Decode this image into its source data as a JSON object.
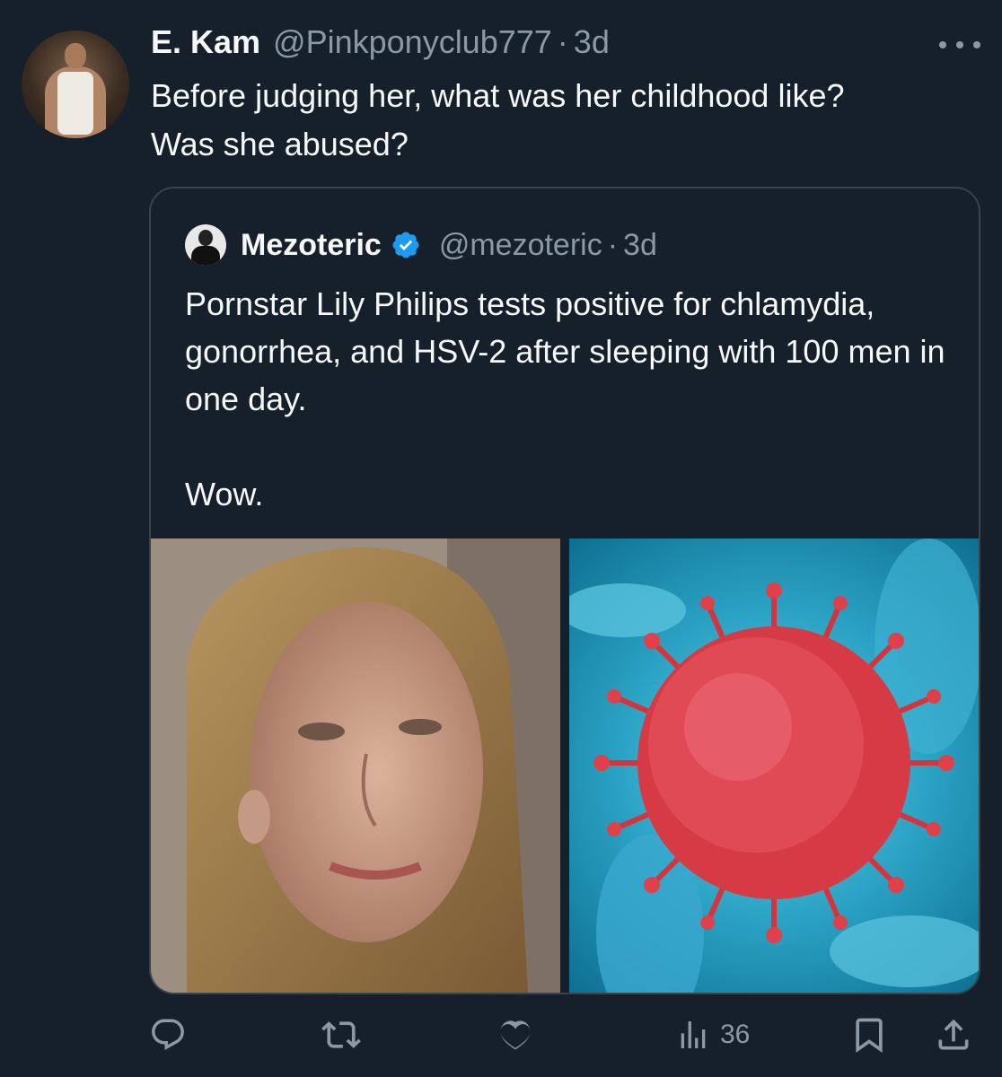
{
  "reply": {
    "display_name": "E. Kam",
    "handle": "@Pinkponyclub777",
    "separator": "·",
    "time": "3d",
    "text": "Before judging her, what was her childhood like?\nWas she abused?"
  },
  "quote": {
    "display_name": "Mezoteric",
    "verified": true,
    "handle": "@mezoteric",
    "separator": "·",
    "time": "3d",
    "text": "Pornstar Lily Philips tests positive for chlamydia, gonorrhea, and HSV-2 after sleeping with 100 men in one day.\n\nWow."
  },
  "actions": {
    "views_count": "36"
  },
  "colors": {
    "background": "#15202b",
    "text_primary": "#f7f9f9",
    "text_secondary": "#8b98a5",
    "border": "#38444d",
    "verified_blue": "#1d9bf0"
  },
  "icons": {
    "more": "more-horizontal-icon",
    "verified": "verified-badge-icon",
    "reply": "reply-icon",
    "retweet": "retweet-icon",
    "like": "heart-icon",
    "views": "views-chart-icon",
    "bookmark": "bookmark-icon",
    "share": "share-icon"
  }
}
